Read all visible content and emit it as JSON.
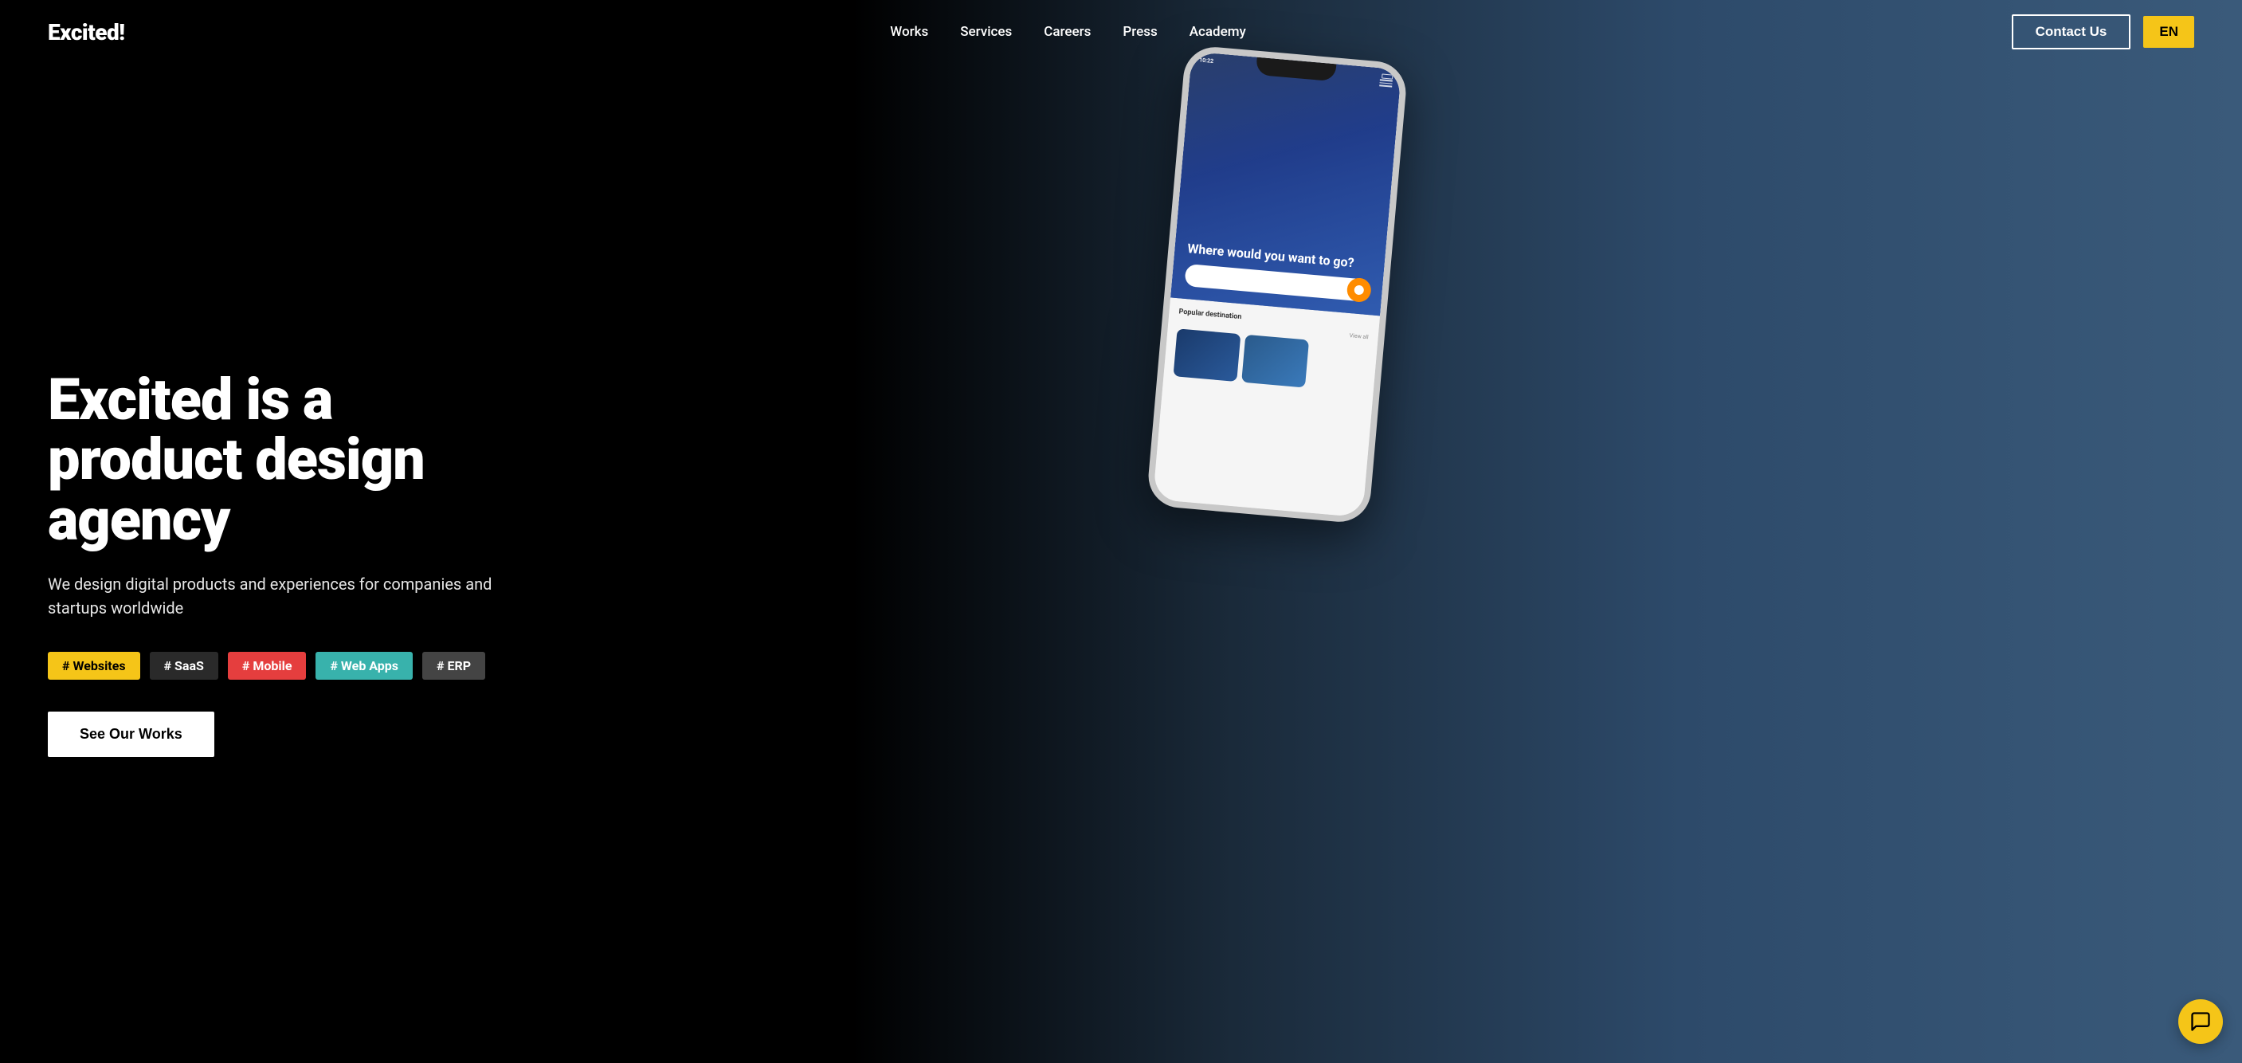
{
  "brand": {
    "logo": "Excited!"
  },
  "navbar": {
    "links": [
      {
        "label": "Works",
        "id": "works"
      },
      {
        "label": "Services",
        "id": "services"
      },
      {
        "label": "Careers",
        "id": "careers"
      },
      {
        "label": "Press",
        "id": "press"
      },
      {
        "label": "Academy",
        "id": "academy"
      }
    ],
    "contact_btn": "Contact Us",
    "lang_btn": "EN"
  },
  "hero": {
    "title": "Excited is a product design agency",
    "subtitle": "We design digital products and experiences for companies and startups worldwide",
    "tags": [
      {
        "label": "# Websites",
        "style": "yellow"
      },
      {
        "label": "# SaaS",
        "style": "dark"
      },
      {
        "label": "# Mobile",
        "style": "red"
      },
      {
        "label": "# Web Apps",
        "style": "teal"
      },
      {
        "label": "# ERP",
        "style": "gray"
      }
    ],
    "cta_btn": "See Our Works"
  },
  "phone": {
    "time": "10:22",
    "question": "Where would you want to go?",
    "popular": "Popular destination",
    "view_all": "View all"
  },
  "chat": {
    "icon": "chat-icon"
  }
}
